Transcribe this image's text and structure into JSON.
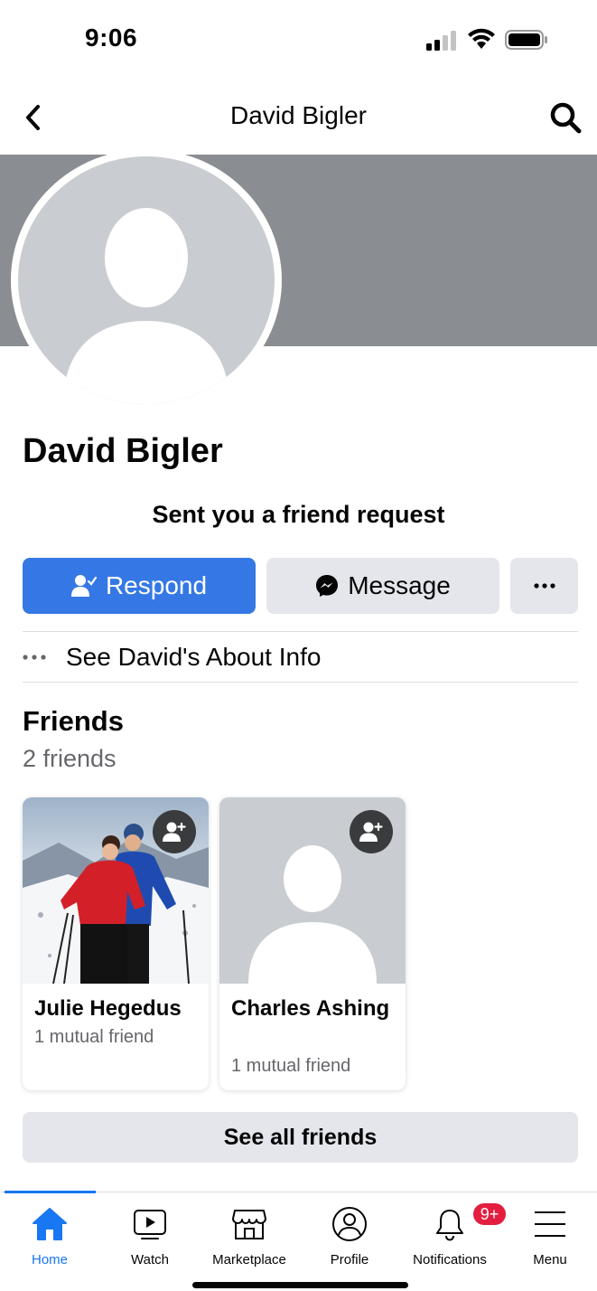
{
  "status_bar": {
    "time": "9:06"
  },
  "nav": {
    "title": "David Bigler"
  },
  "profile": {
    "name": "David Bigler",
    "request_text": "Sent you a friend request"
  },
  "actions": {
    "respond_label": "Respond",
    "message_label": "Message",
    "more_label": "•••"
  },
  "about": {
    "dots": "•••",
    "label": "See David's About Info"
  },
  "friends": {
    "heading": "Friends",
    "count": "2 friends",
    "items": [
      {
        "name": "Julie Hegedus",
        "mutual": "1 mutual friend"
      },
      {
        "name": "Charles Ashing",
        "mutual": "1 mutual friend"
      }
    ],
    "see_all_label": "See all friends"
  },
  "tabbar": {
    "active": "Home",
    "tabs": [
      {
        "label": "Home",
        "icon": "home-icon"
      },
      {
        "label": "Watch",
        "icon": "watch-icon"
      },
      {
        "label": "Marketplace",
        "icon": "marketplace-icon"
      },
      {
        "label": "Profile",
        "icon": "profile-icon"
      },
      {
        "label": "Notifications",
        "icon": "bell-icon",
        "badge": "9+"
      },
      {
        "label": "Menu",
        "icon": "menu-icon"
      }
    ]
  },
  "colors": {
    "accent": "#1877f2",
    "respond_button": "#3578e5",
    "cover": "#8a8d91",
    "badge": "#e41e3f"
  }
}
